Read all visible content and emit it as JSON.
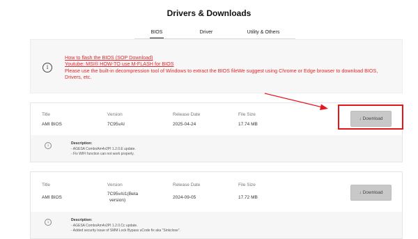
{
  "header": {
    "title": "Drivers & Downloads"
  },
  "tabs": [
    {
      "label": "BIOS",
      "active": true
    },
    {
      "label": "Driver",
      "active": false
    },
    {
      "label": "Utility & Others",
      "active": false
    }
  ],
  "notice": {
    "icon": "info-icon",
    "link1": "How to flash the BIOS (SOP Download)",
    "link2": "Youtube: MSI® HOW-TO use M-FLASH for BIOS",
    "text": "Please use the built-in decompression tool of Windows to extract the BIOS fileWe suggest using Chrome or Edge browser to download BIOS, Drivers, etc.",
    "color": "#e4262c"
  },
  "columns": {
    "title": "Title",
    "version": "Version",
    "release_date": "Release Date",
    "file_size": "File Size"
  },
  "downloads": [
    {
      "title": "AMI BIOS",
      "version": "7C95vAI",
      "release_date": "2025-04-24",
      "file_size": "17.74 MB",
      "button": "↓ Download",
      "description_title": "Description:",
      "description": [
        "- AGESA ComboAm4v2PI 1.2.0.E update.",
        "- Fix WIFI function can not work properly."
      ]
    },
    {
      "title": "AMI BIOS",
      "version_line1": "7C95vAI1(Beta",
      "version_line2": "version)",
      "release_date": "2024-09-05",
      "file_size": "17.72 MB",
      "button": "↓ Download",
      "description_title": "Description:",
      "description": [
        "- AGESA ComboAm4v2PI 1.2.0.Cc update.",
        "- Added security issue of SMM Lock Bypass uCode fix aka \"Sinkclose\"."
      ]
    }
  ],
  "annotation": {
    "color": "#e8141c"
  }
}
